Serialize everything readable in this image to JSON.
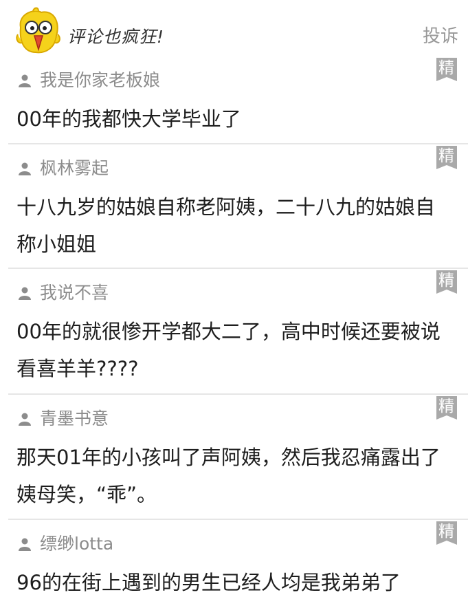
{
  "header": {
    "title": "评论也疯狂!",
    "report_label": "投诉",
    "mascot_icon": "yellow-chick-mascot"
  },
  "badge_label": "精",
  "comments": [
    {
      "username": "我是你家老板娘",
      "text": "00年的我都快大学毕业了"
    },
    {
      "username": "枫林雾起",
      "text": "十八九岁的姑娘自称老阿姨，二十八九的姑娘自称小姐姐"
    },
    {
      "username": "我说不喜",
      "text": "00年的就很惨开学都大二了，高中时候还要被说看喜羊羊????"
    },
    {
      "username": "青墨书意",
      "text": "那天01年的小孩叫了声阿姨，然后我忍痛露出了姨母笑，“乖”。"
    },
    {
      "username": "缥缈lotta",
      "text": "96的在街上遇到的男生已经人均是我弟弟了"
    }
  ],
  "colors": {
    "badge_bg": "#a9a9a9",
    "username": "#8c8c8c",
    "divider": "#e6e6e6",
    "mascot": "#f5d21b"
  }
}
